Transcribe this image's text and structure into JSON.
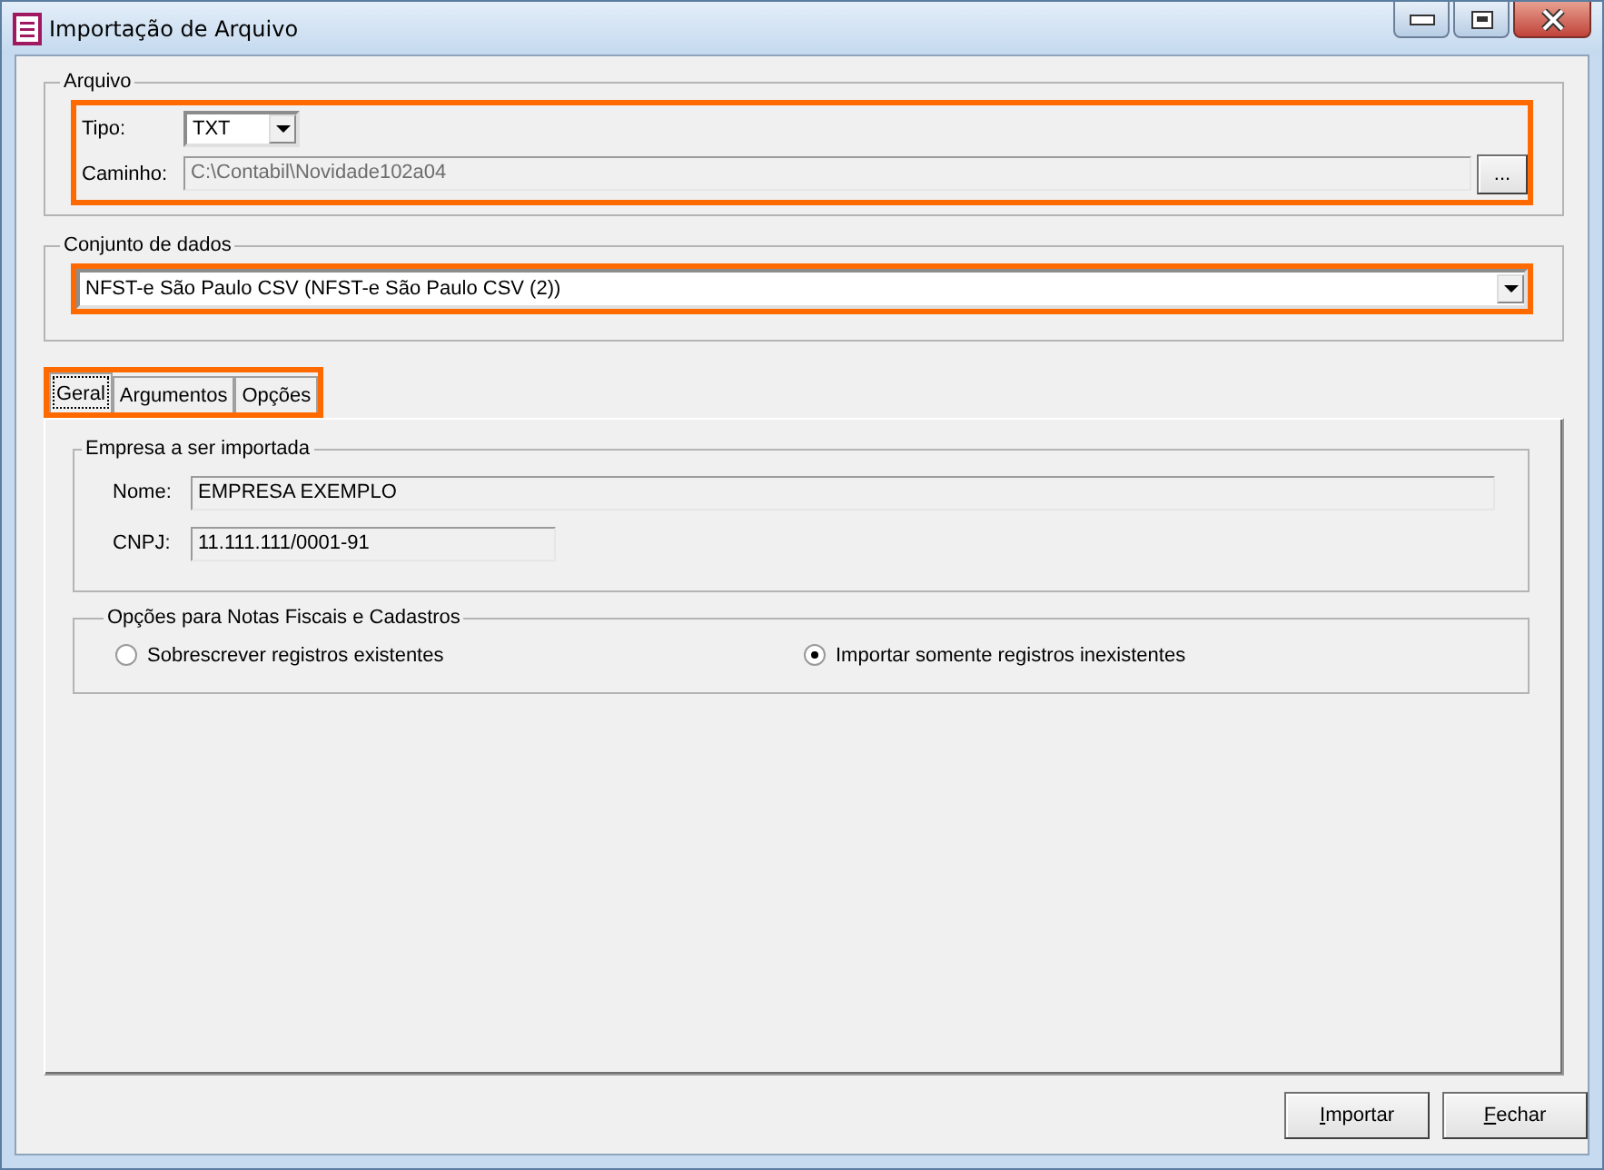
{
  "window": {
    "title": "Importação de Arquivo"
  },
  "arquivo": {
    "legend": "Arquivo",
    "highlighted": true,
    "tipo": {
      "label": "Tipo:",
      "value": "TXT"
    },
    "caminho": {
      "label": "Caminho:",
      "value": "C:\\Contabil\\Novidade102a04",
      "disabled": true,
      "browse": "..."
    }
  },
  "conjunto": {
    "legend": "Conjunto de dados",
    "highlighted": true,
    "value": "NFST-e São Paulo CSV (NFST-e São Paulo CSV (2))"
  },
  "tabs_highlighted": true,
  "tabs": [
    {
      "label": "Geral",
      "selected": true
    },
    {
      "label": "Argumentos",
      "selected": false
    },
    {
      "label": "Opções",
      "selected": false
    }
  ],
  "empresa": {
    "legend": "Empresa a ser importada",
    "fields": [
      {
        "label": "Nome:",
        "value": "EMPRESA EXEMPLO"
      },
      {
        "label": "CNPJ:",
        "value": "11.111.111/0001-91"
      }
    ]
  },
  "opcoes": {
    "legend": "Opções para Notas Fiscais e Cadastros",
    "radios": [
      {
        "label": "Sobrescrever registros existentes",
        "selected": false
      },
      {
        "label": "Importar somente registros inexistentes",
        "selected": true
      }
    ]
  },
  "buttons": [
    {
      "label": "Importar"
    },
    {
      "label": "Fechar"
    }
  ]
}
